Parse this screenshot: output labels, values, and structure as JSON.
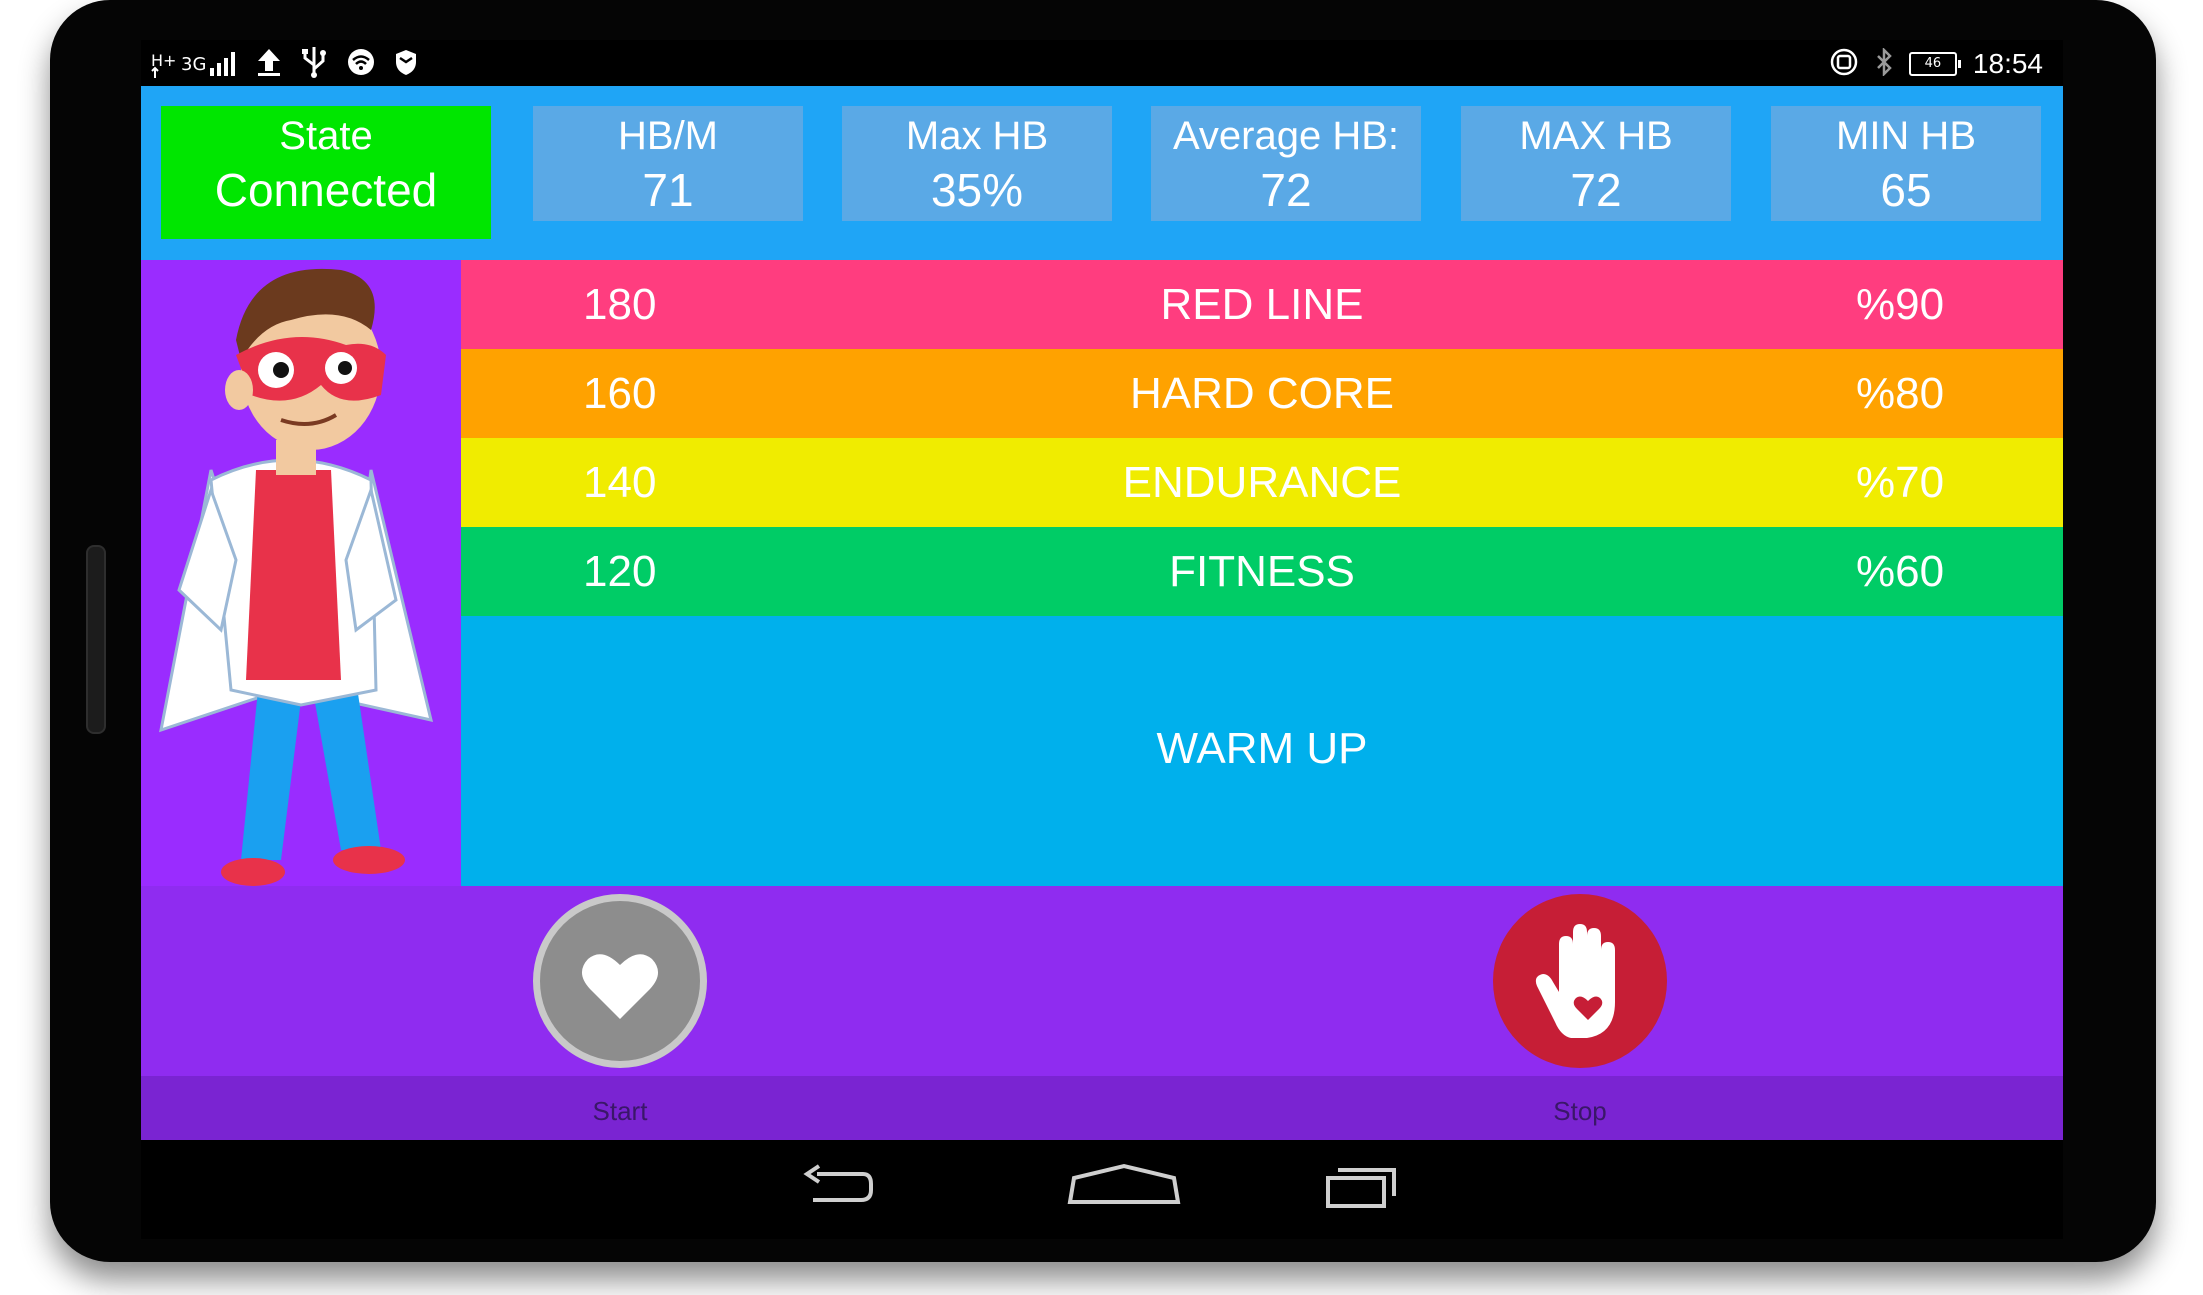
{
  "status_bar": {
    "network": "3G",
    "battery": "46",
    "time": "18:54",
    "icons": [
      "signal-icon",
      "upload-icon",
      "usb-icon",
      "wifi-icon",
      "shield-icon",
      "sync-icon",
      "bluetooth-icon",
      "battery-icon"
    ]
  },
  "stats": {
    "state": {
      "label": "State",
      "value": "Connected"
    },
    "hbm": {
      "label": "HB/M",
      "value": "71"
    },
    "max_hb_pct": {
      "label": "Max HB",
      "value": "35%"
    },
    "average_hb": {
      "label": "Average HB:",
      "value": "72"
    },
    "max_hb": {
      "label": "MAX HB",
      "value": "72"
    },
    "min_hb": {
      "label": "MIN HB",
      "value": "65"
    }
  },
  "zones": [
    {
      "bpm": "180",
      "name": "RED LINE",
      "percent": "%90",
      "color": "#ff3d7f"
    },
    {
      "bpm": "160",
      "name": "HARD CORE",
      "percent": "%80",
      "color": "#ffa200"
    },
    {
      "bpm": "140",
      "name": "ENDURANCE",
      "percent": "%70",
      "color": "#f0ec00"
    },
    {
      "bpm": "120",
      "name": "FITNESS",
      "percent": "%60",
      "color": "#00cc66"
    }
  ],
  "warm_up": {
    "name": "WARM UP",
    "color": "#00b0ec"
  },
  "controls": {
    "start_label": "Start",
    "stop_label": "Stop"
  },
  "colors": {
    "header_bg": "#1fa5f6",
    "state_bg": "#00e600",
    "panel_purple": "#9a2cff",
    "stop_red": "#c61e36"
  }
}
